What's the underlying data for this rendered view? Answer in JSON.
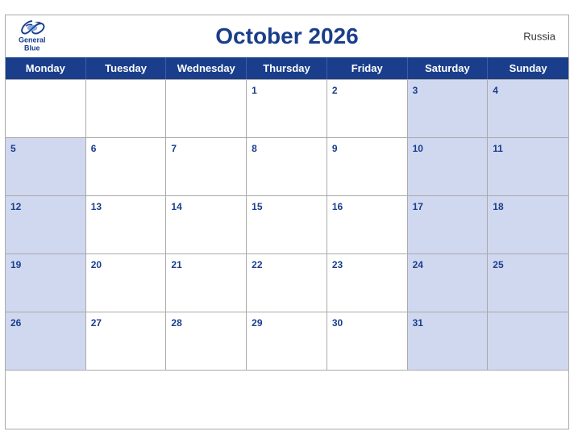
{
  "header": {
    "title": "October 2026",
    "country": "Russia",
    "logo": {
      "line1": "General",
      "line2": "Blue"
    }
  },
  "dayHeaders": [
    "Monday",
    "Tuesday",
    "Wednesday",
    "Thursday",
    "Friday",
    "Saturday",
    "Sunday"
  ],
  "weeks": [
    [
      {
        "num": "",
        "shaded": false
      },
      {
        "num": "",
        "shaded": false
      },
      {
        "num": "",
        "shaded": false
      },
      {
        "num": "1",
        "shaded": false
      },
      {
        "num": "2",
        "shaded": false
      },
      {
        "num": "3",
        "shaded": true
      },
      {
        "num": "4",
        "shaded": true
      }
    ],
    [
      {
        "num": "5",
        "shaded": true
      },
      {
        "num": "6",
        "shaded": false
      },
      {
        "num": "7",
        "shaded": false
      },
      {
        "num": "8",
        "shaded": false
      },
      {
        "num": "9",
        "shaded": false
      },
      {
        "num": "10",
        "shaded": true
      },
      {
        "num": "11",
        "shaded": true
      }
    ],
    [
      {
        "num": "12",
        "shaded": true
      },
      {
        "num": "13",
        "shaded": false
      },
      {
        "num": "14",
        "shaded": false
      },
      {
        "num": "15",
        "shaded": false
      },
      {
        "num": "16",
        "shaded": false
      },
      {
        "num": "17",
        "shaded": true
      },
      {
        "num": "18",
        "shaded": true
      }
    ],
    [
      {
        "num": "19",
        "shaded": true
      },
      {
        "num": "20",
        "shaded": false
      },
      {
        "num": "21",
        "shaded": false
      },
      {
        "num": "22",
        "shaded": false
      },
      {
        "num": "23",
        "shaded": false
      },
      {
        "num": "24",
        "shaded": true
      },
      {
        "num": "25",
        "shaded": true
      }
    ],
    [
      {
        "num": "26",
        "shaded": true
      },
      {
        "num": "27",
        "shaded": false
      },
      {
        "num": "28",
        "shaded": false
      },
      {
        "num": "29",
        "shaded": false
      },
      {
        "num": "30",
        "shaded": false
      },
      {
        "num": "31",
        "shaded": true
      },
      {
        "num": "",
        "shaded": true
      }
    ]
  ]
}
